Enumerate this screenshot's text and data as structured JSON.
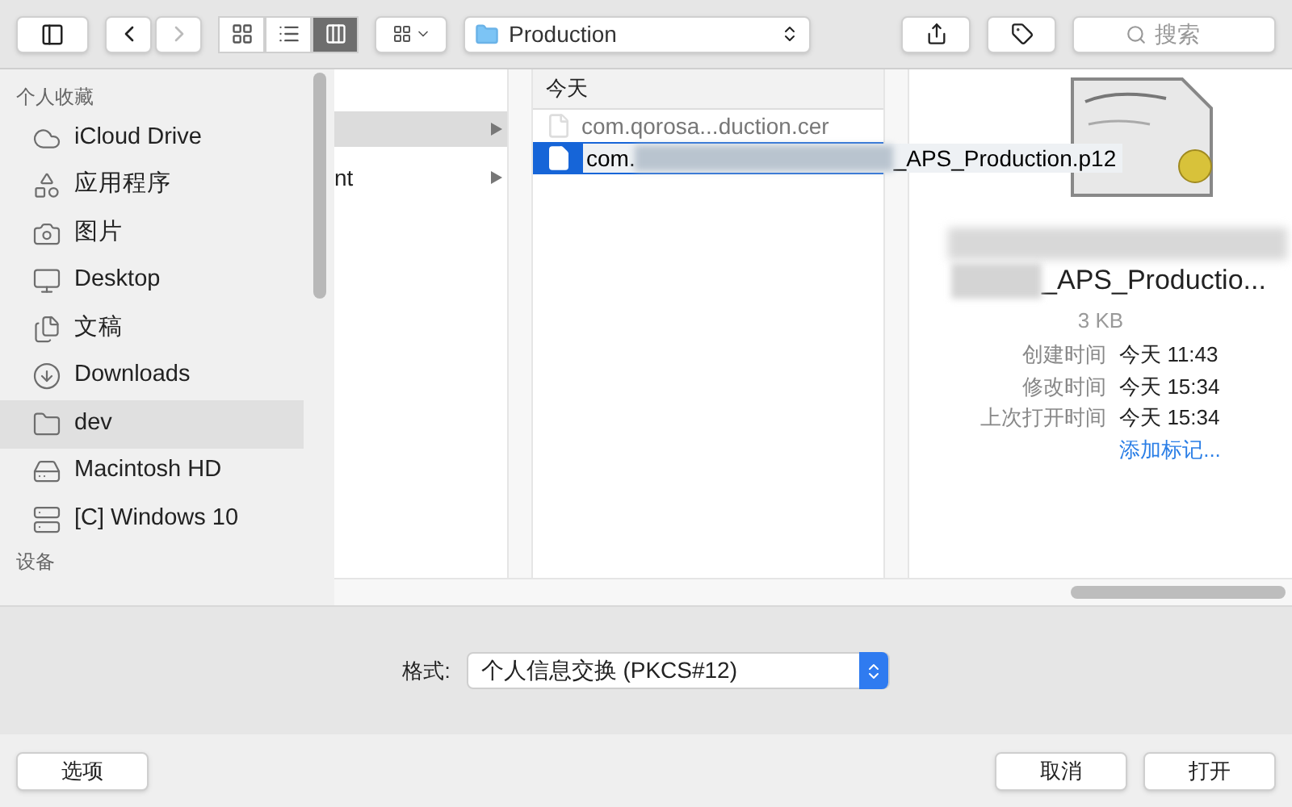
{
  "toolbar": {
    "view_modes": [
      {
        "kind": "icons",
        "selected": false
      },
      {
        "kind": "list",
        "selected": false
      },
      {
        "kind": "columns",
        "selected": true
      }
    ],
    "location": "Production",
    "search": {
      "placeholder": "搜索"
    }
  },
  "sidebar": {
    "sections": [
      {
        "title": "个人收藏",
        "items": [
          {
            "label": "iCloud Drive",
            "kind": "cloud",
            "selected": false
          },
          {
            "label": "应用程序",
            "kind": "apps",
            "selected": false
          },
          {
            "label": "图片",
            "kind": "camera",
            "selected": false
          },
          {
            "label": "Desktop",
            "kind": "desktop",
            "selected": false
          },
          {
            "label": "文稿",
            "kind": "documents",
            "selected": false
          },
          {
            "label": "Downloads",
            "kind": "downloads",
            "selected": false
          },
          {
            "label": "dev",
            "kind": "folder",
            "selected": true
          },
          {
            "label": "Macintosh HD",
            "kind": "drive",
            "selected": false
          },
          {
            "label": "[C] Windows 10",
            "kind": "disk",
            "selected": false
          }
        ]
      },
      {
        "title": "设备"
      }
    ]
  },
  "column_1": {
    "rows": [
      {
        "selected": true,
        "has_children": true
      },
      {
        "label": "nt",
        "selected": false,
        "has_children": true
      }
    ]
  },
  "column_2": {
    "header": "今天",
    "files": [
      {
        "name": "com.qorosa...duction.cer",
        "selected": false
      },
      {
        "name_start": "com.",
        "name_end": "_APS_Production.p12",
        "selected": true
      }
    ]
  },
  "preview": {
    "name": "_APS_Productio...",
    "size": "3 KB",
    "info": [
      {
        "label": "创建时间",
        "value": "今天 11:43"
      },
      {
        "label": "修改时间",
        "value": "今天 15:34"
      },
      {
        "label": "上次打开时间",
        "value": "今天 15:34"
      }
    ],
    "add_tags": "添加标记..."
  },
  "format": {
    "label": "格式:",
    "value": "个人信息交换 (PKCS#12)"
  },
  "buttons": {
    "options": "选项",
    "cancel": "取消",
    "open": "打开"
  }
}
